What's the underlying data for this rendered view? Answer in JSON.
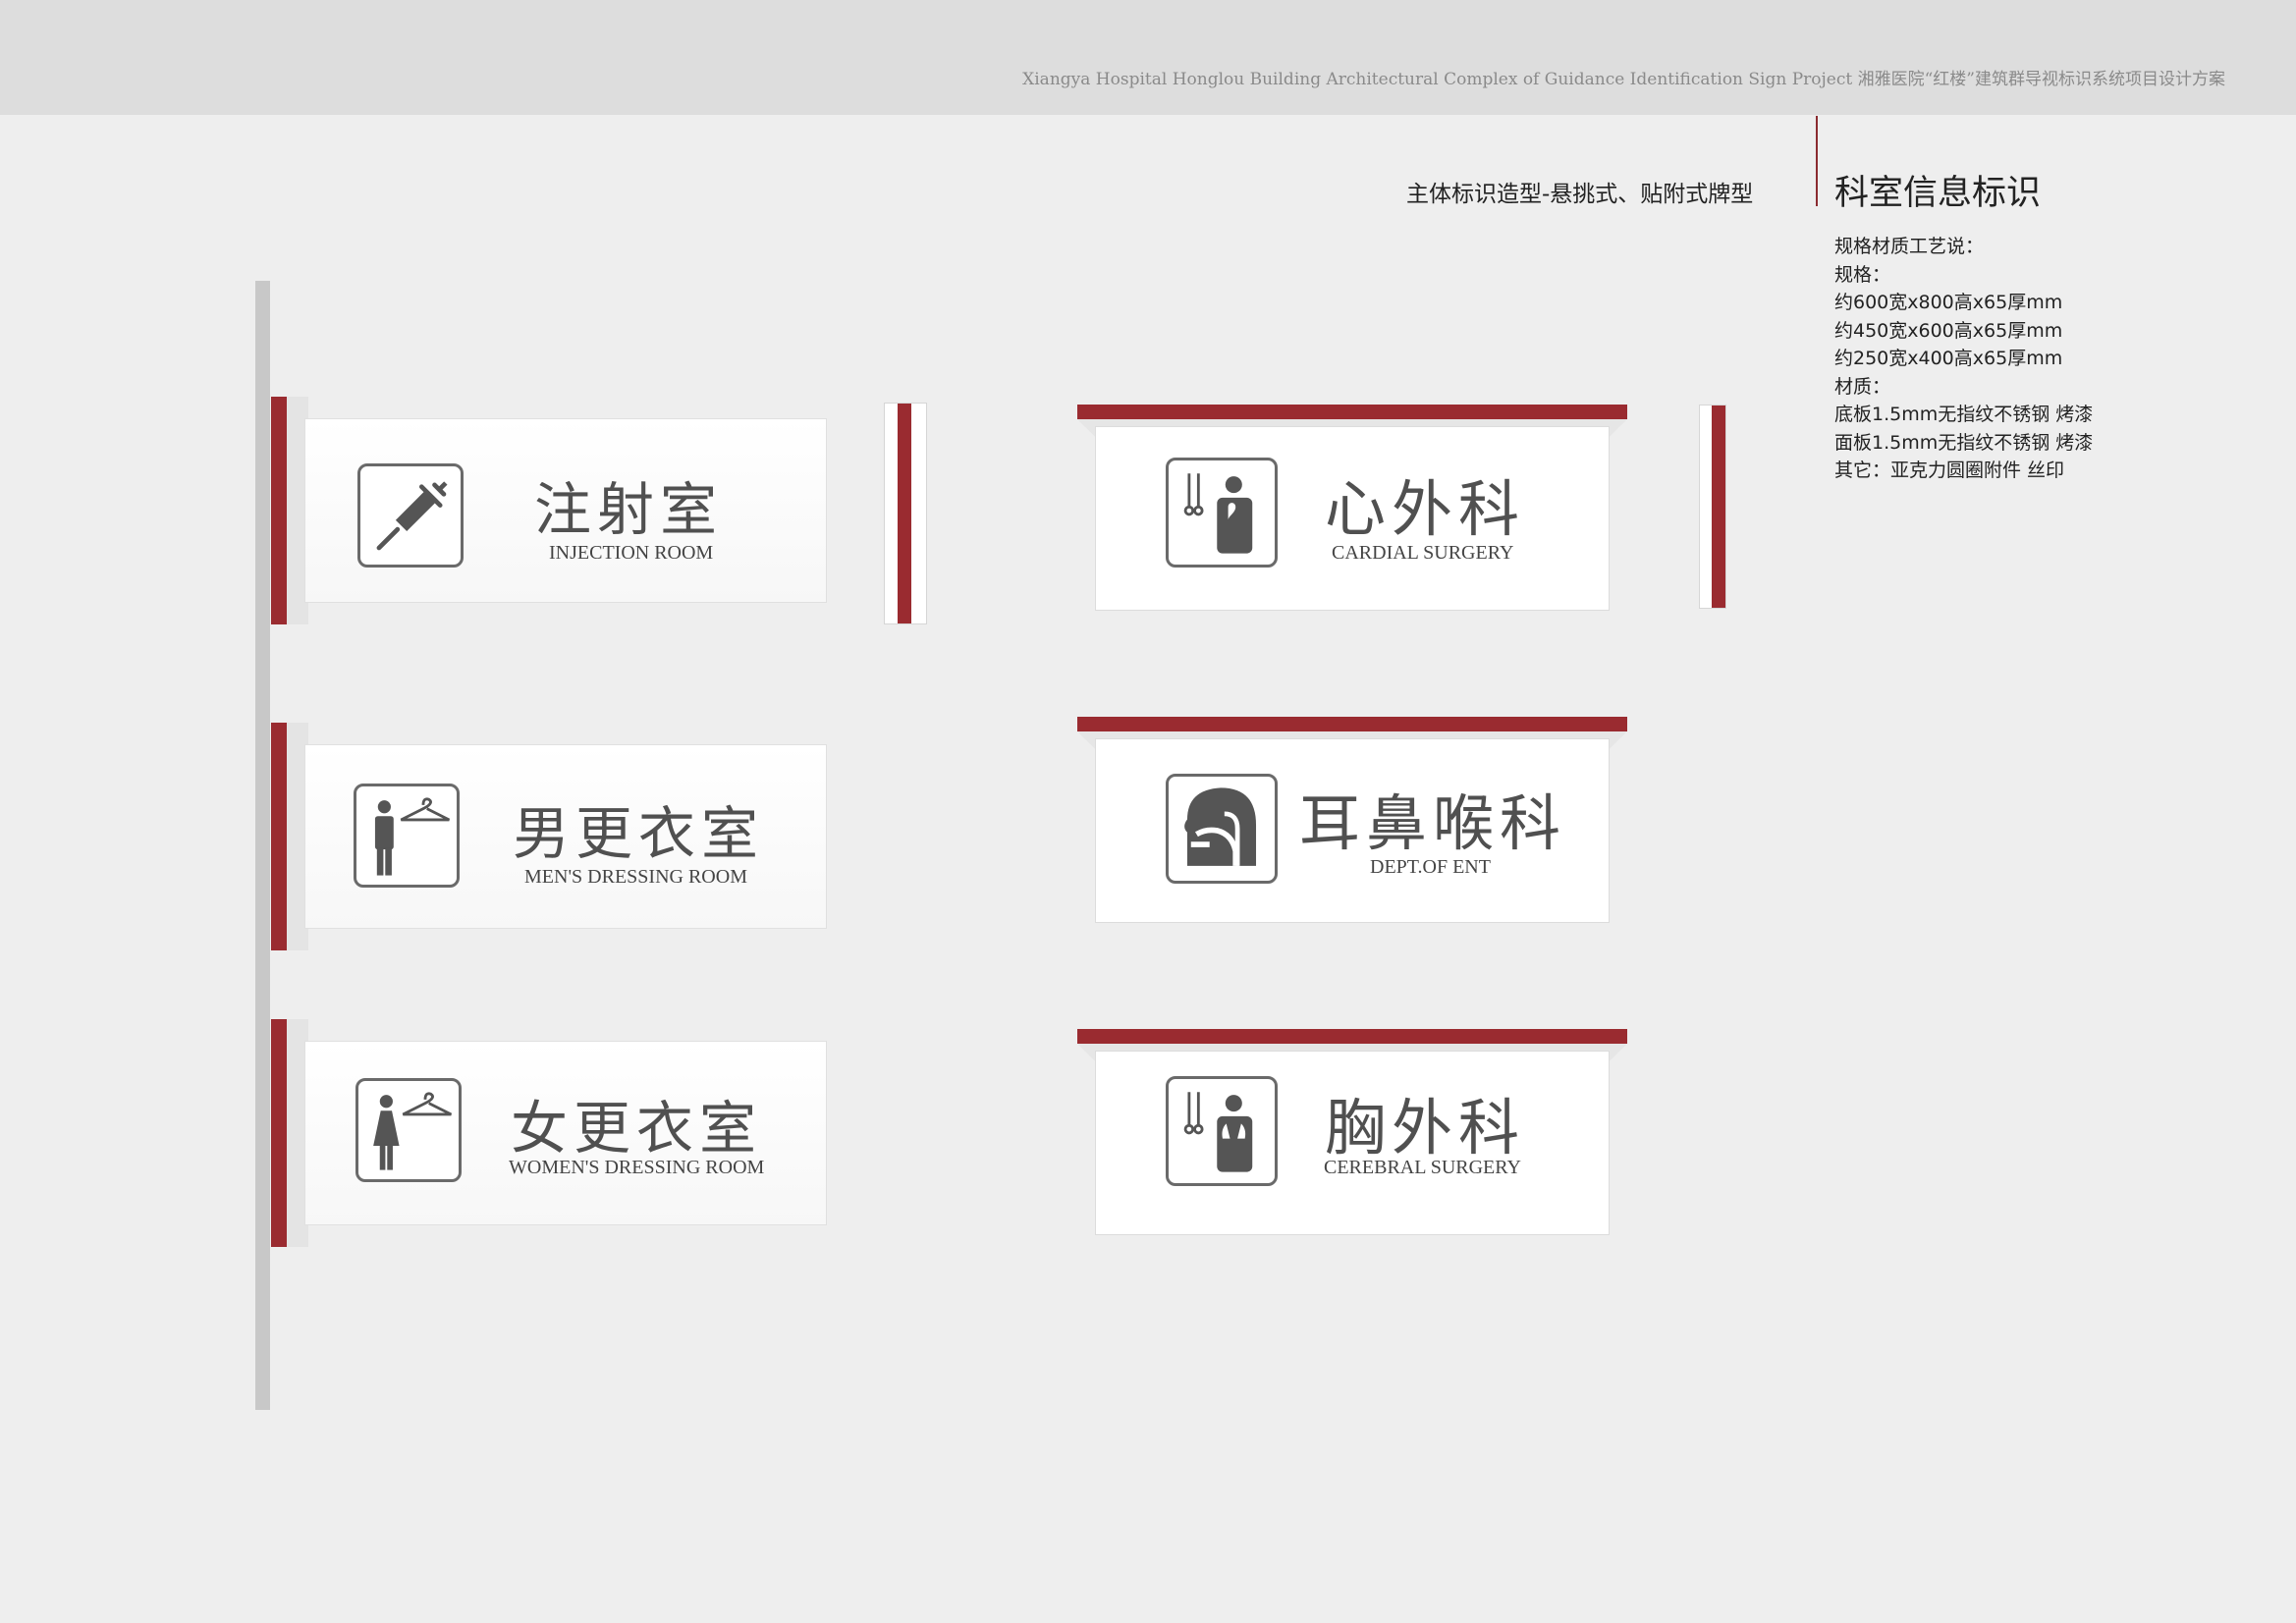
{
  "header": {
    "project_title": "Xiangya Hospital Honglou Building Architectural Complex of Guidance Identification Sign Project   湘雅医院“红楼”建筑群导视标识系统项目设计方案"
  },
  "subtitle": "主体标识造型-悬挑式、贴附式牌型",
  "section_title": "科室信息标识",
  "spec_lines": [
    "规格材质工艺说：",
    "规格：",
    "约600宽x800高x65厚mm",
    "约450宽x600高x65厚mm",
    "约250宽x400高x65厚mm",
    "材质：",
    "底板1.5mm无指纹不锈钢 烤漆",
    "面板1.5mm无指纹不锈钢 烤漆",
    "其它：亚克力圆圈附件 丝印"
  ],
  "flag_signs": [
    {
      "cn": "注射室",
      "en": "INJECTION ROOM",
      "icon": "syringe-icon"
    },
    {
      "cn": "男更衣室",
      "en": "MEN'S DRESSING ROOM",
      "icon": "man-hanger-icon"
    },
    {
      "cn": "女更衣室",
      "en": "WOMEN'S DRESSING ROOM",
      "icon": "woman-hanger-icon"
    }
  ],
  "hanging_signs": [
    {
      "cn": "心外科",
      "en": "CARDIAL SURGERY",
      "icon": "heart-surgeon-icon"
    },
    {
      "cn": "耳鼻喉科",
      "en": "DEPT.OF ENT",
      "icon": "ent-head-icon"
    },
    {
      "cn": "胸外科",
      "en": "CEREBRAL SURGERY",
      "icon": "lung-surgeon-icon"
    }
  ],
  "colors": {
    "accent": "#9a2b30",
    "text": "#505050",
    "pole": "#c8c8c8"
  }
}
